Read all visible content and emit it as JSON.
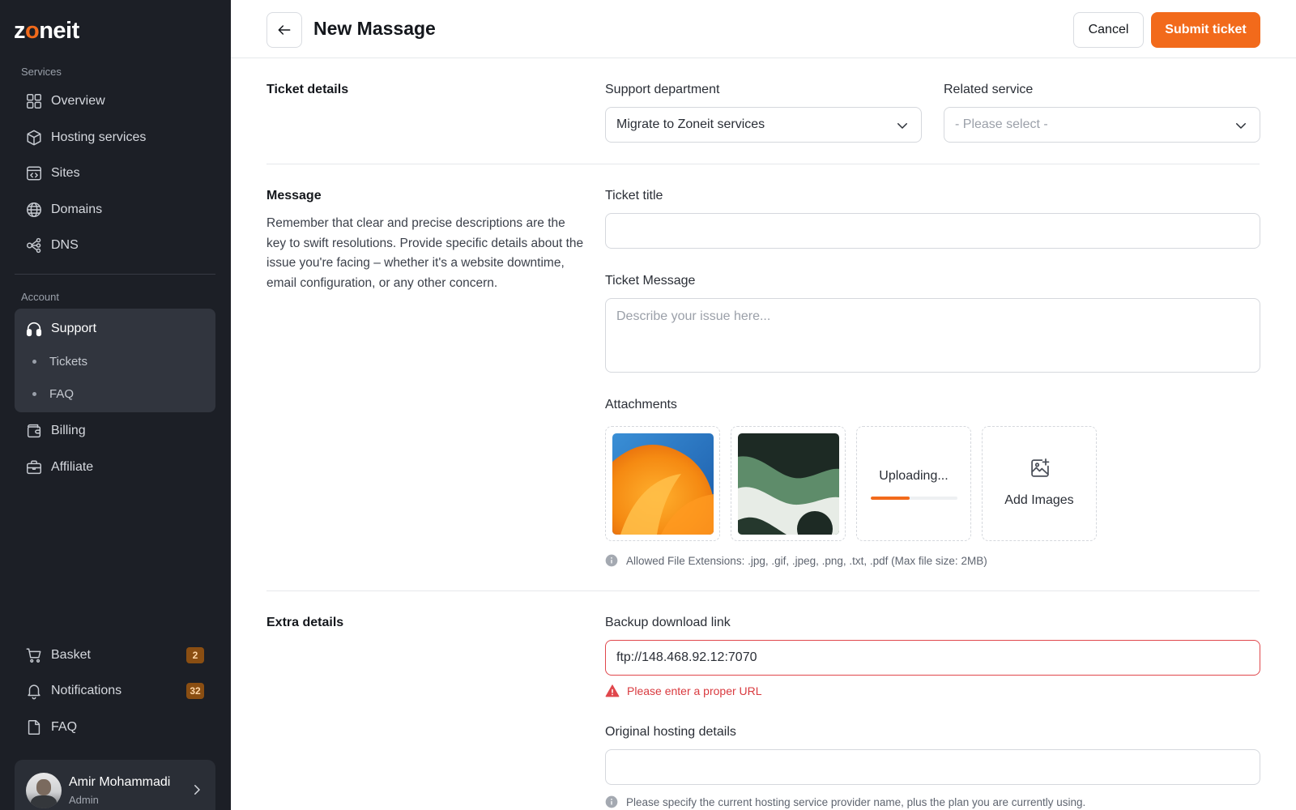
{
  "brand": {
    "logo_pre": "z",
    "logo_o": "o",
    "logo_post": "neit"
  },
  "sidebar": {
    "services_label": "Services",
    "account_label": "Account",
    "services": [
      {
        "label": "Overview",
        "icon": "grid-icon"
      },
      {
        "label": "Hosting services",
        "icon": "cube-icon"
      },
      {
        "label": "Sites",
        "icon": "code-window-icon"
      },
      {
        "label": "Domains",
        "icon": "globe-icon"
      },
      {
        "label": "DNS",
        "icon": "network-icon"
      }
    ],
    "support": {
      "label": "Support",
      "icon": "headset-icon",
      "sub": [
        "Tickets",
        "FAQ"
      ]
    },
    "account": [
      {
        "label": "Billing",
        "icon": "wallet-icon"
      },
      {
        "label": "Affiliate",
        "icon": "briefcase-icon"
      }
    ],
    "bottom": [
      {
        "label": "Basket",
        "icon": "cart-icon",
        "badge": "2"
      },
      {
        "label": "Notifications",
        "icon": "bell-icon",
        "badge": "32"
      },
      {
        "label": "FAQ",
        "icon": "document-icon"
      }
    ],
    "user": {
      "name": "Amir Mohammadi",
      "role": "Admin"
    }
  },
  "header": {
    "title": "New Massage",
    "cancel_label": "Cancel",
    "submit_label": "Submit ticket"
  },
  "ticket_details": {
    "title": "Ticket details",
    "department_label": "Support department",
    "department_value": "Migrate to Zoneit services",
    "service_label": "Related service",
    "service_placeholder": "- Please select -"
  },
  "message": {
    "title": "Message",
    "description": "Remember that clear and precise descriptions are the key to swift resolutions. Provide specific details about the issue you're facing – whether it's a website downtime, email configuration, or any other concern.",
    "ticket_title_label": "Ticket title",
    "ticket_title_value": "",
    "ticket_message_label": "Ticket Message",
    "ticket_message_placeholder": "Describe your issue here...",
    "attachments_label": "Attachments",
    "uploading_text": "Uploading...",
    "upload_progress": 0.45,
    "add_images_label": "Add Images",
    "allowed_hint": "Allowed File Extensions: .jpg, .gif, .jpeg, .png, .txt, .pdf (Max file size: 2MB)"
  },
  "extra_details": {
    "title": "Extra details",
    "backup_label": "Backup download link",
    "backup_value": "ftp://148.468.92.12:7070",
    "backup_error": "Please enter a proper URL",
    "hosting_label": "Original hosting details",
    "hosting_value": "",
    "hosting_hint": "Please specify the current hosting service provider name, plus the plan you are currently using."
  },
  "colors": {
    "accent": "#f26a1b",
    "sidebar_bg": "#1c1f26",
    "error": "#d93a3f"
  }
}
